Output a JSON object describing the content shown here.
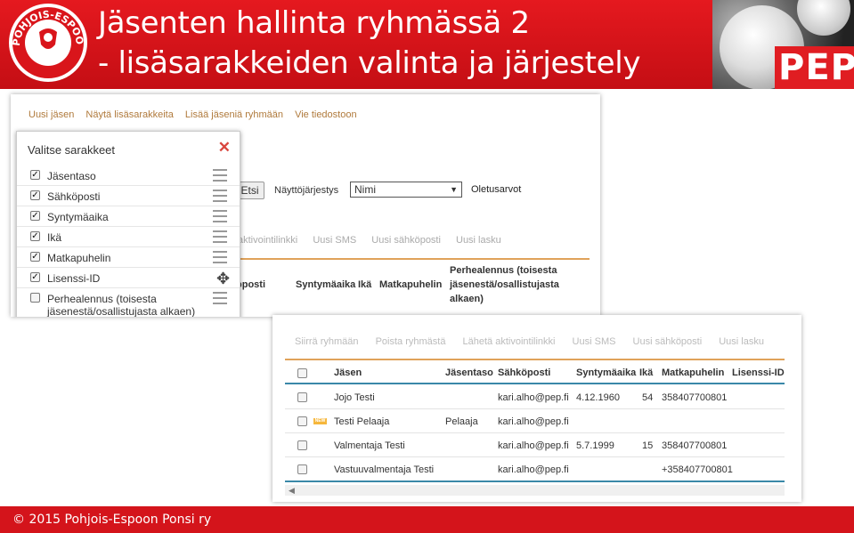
{
  "header": {
    "title_line1": "Jäsenten hallinta ryhmässä 2",
    "title_line2": "- lisäsarakkeiden valinta ja järjestely",
    "logo_text": "POHJOIS-ESPOON PONSI",
    "brand_text": "PEP"
  },
  "shot1": {
    "toplinks": [
      "Uusi jäsen",
      "Näytä lisäsarakkeita",
      "Lisää jäseniä ryhmään",
      "Vie tiedostoon"
    ],
    "search_button": "Etsi",
    "sort_label": "Näyttöjärjestys",
    "sort_value": "Nimi",
    "defaults_link": "Oletusarvot",
    "actions": [
      "aktivointilinkki",
      "Uusi SMS",
      "Uusi sähköposti",
      "Uusi lasku"
    ],
    "headers": [
      "pposti",
      "Syntymäaika",
      "Ikä",
      "Matkapuhelin",
      "Perhealennus (toisesta jäsenestä/osallistujasta alkaen)"
    ],
    "popup": {
      "title": "Valitse sarakkeet",
      "items": [
        {
          "label": "Jäsentaso",
          "checked": true
        },
        {
          "label": "Sähköposti",
          "checked": true
        },
        {
          "label": "Syntymäaika",
          "checked": true
        },
        {
          "label": "Ikä",
          "checked": true
        },
        {
          "label": "Matkapuhelin",
          "checked": true
        },
        {
          "label": "Lisenssi-ID",
          "checked": true
        },
        {
          "label": "Perhealennus (toisesta jäsenestä/osallistujasta alkaen)",
          "checked": false
        }
      ]
    }
  },
  "shot2": {
    "actions": [
      "Siirrä ryhmään",
      "Poista ryhmästä",
      "Lähetä aktivointilinkki",
      "Uusi SMS",
      "Uusi sähköposti",
      "Uusi lasku"
    ],
    "columns": [
      "Jäsen",
      "Jäsentaso",
      "Sähköposti",
      "Syntymäaika",
      "Ikä",
      "Matkapuhelin",
      "Lisenssi-ID"
    ],
    "new_badge": "NEW",
    "rows": [
      {
        "name": "Jojo Testi",
        "level": "",
        "email": "kari.alho@pep.fi",
        "birth": "4.12.1960",
        "age": "54",
        "phone": "358407700801",
        "license": "",
        "is_new": false
      },
      {
        "name": "Testi Pelaaja",
        "level": "Pelaaja",
        "email": "kari.alho@pep.fi",
        "birth": "",
        "age": "",
        "phone": "",
        "license": "",
        "is_new": true
      },
      {
        "name": "Valmentaja Testi",
        "level": "",
        "email": "kari.alho@pep.fi",
        "birth": "5.7.1999",
        "age": "15",
        "phone": "358407700801",
        "license": "",
        "is_new": false
      },
      {
        "name": "Vastuuvalmentaja Testi",
        "level": "",
        "email": "kari.alho@pep.fi",
        "birth": "",
        "age": "",
        "phone": "+358407700801",
        "license": "",
        "is_new": false
      }
    ]
  },
  "footer": {
    "text": "© 2015 Pohjois-Espoon Ponsi ry"
  }
}
